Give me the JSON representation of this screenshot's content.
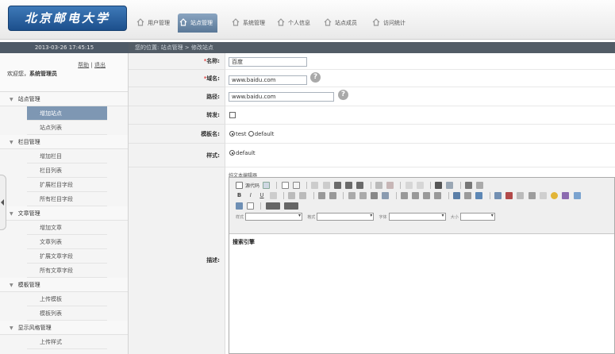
{
  "logo": {
    "text": "北京邮电大学"
  },
  "nav": {
    "tabs": [
      {
        "label": "用户管理",
        "active": false
      },
      {
        "label": "站点管理",
        "active": true
      },
      {
        "label": "系统管理",
        "active": false
      },
      {
        "label": "个人信息",
        "active": false
      },
      {
        "label": "站点成员",
        "active": false
      },
      {
        "label": "访问统计",
        "active": false
      }
    ]
  },
  "status": {
    "datetime": "2013-03-26  17:45:15"
  },
  "breadcrumb": {
    "text": "您的位置: 站点管理 > 修改站点"
  },
  "user": {
    "help": "帮助",
    "sep": "|",
    "logout": "退出",
    "welcome": "欢迎您，",
    "name": "系统管理员"
  },
  "sidebar": {
    "groups": [
      {
        "label": "站点管理",
        "items": [
          {
            "label": "增加站点",
            "active": true
          },
          {
            "label": "站点列表",
            "active": false
          }
        ]
      },
      {
        "label": "栏目管理",
        "items": [
          {
            "label": "增加栏目"
          },
          {
            "label": "栏目列表"
          },
          {
            "label": "扩展栏目字段"
          },
          {
            "label": "所有栏目字段"
          }
        ]
      },
      {
        "label": "文章管理",
        "items": [
          {
            "label": "增加文章"
          },
          {
            "label": "文章列表"
          },
          {
            "label": "扩展文章字段"
          },
          {
            "label": "所有文章字段"
          }
        ]
      },
      {
        "label": "模板管理",
        "items": [
          {
            "label": "上传模板"
          },
          {
            "label": "模板列表"
          }
        ]
      },
      {
        "label": "显示风格管理",
        "items": [
          {
            "label": "上传样式"
          }
        ]
      }
    ]
  },
  "form": {
    "name": {
      "label": "名称:",
      "required": "*",
      "value": "百度"
    },
    "domain": {
      "label": "域名:",
      "required": "*",
      "value": "www.baidu.com"
    },
    "path": {
      "label": "路径:",
      "value": "www.baidu.com"
    },
    "redirect": {
      "label": "转发:"
    },
    "template": {
      "label": "模板名:",
      "options": [
        "test",
        "default"
      ],
      "selected": "test"
    },
    "style": {
      "label": "样式:",
      "options": [
        "default"
      ],
      "selected": "default"
    },
    "desc": {
      "label": "描述:",
      "editor_title": "纯文本编辑器",
      "content": "搜索引擎"
    },
    "toolbar": {
      "source": "源代码",
      "format_style": "样式",
      "format": "格式",
      "font": "字体",
      "size": "大小"
    },
    "help_glyph": "?"
  },
  "colors": {
    "accent": "#7e97b3",
    "header_bar": "#525c66",
    "logo_bg": "#2a5f9e"
  }
}
